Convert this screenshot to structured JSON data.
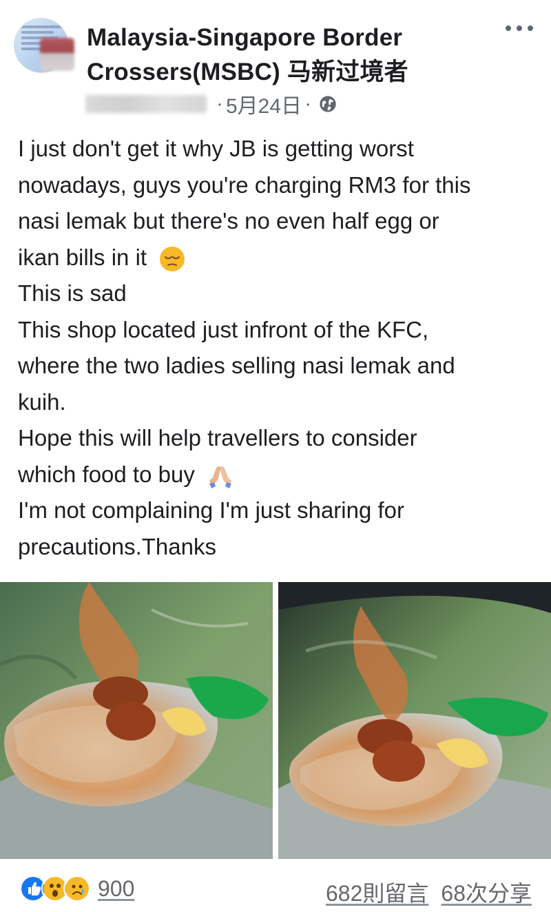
{
  "post": {
    "group_name": "Malaysia-Singapore Border Crossers(MSBC) 马新过境者",
    "meta": {
      "separator": "·",
      "date": "5月24日",
      "separator2": "·",
      "privacy_icon": "globe-icon"
    },
    "body": {
      "lines": [
        "I just don't get it why JB is getting worst",
        "nowadays, guys you're charging RM3 for this",
        "nasi lemak but there's no even half egg or",
        "ikan bills in it",
        "This is sad",
        "This shop located just infront of the KFC,",
        "where the two ladies selling nasi lemak and",
        "kuih.",
        "Hope this will help travellers to consider",
        "which food to buy",
        "I'm not complaining I'm just sharing for",
        "precautions.Thanks"
      ]
    },
    "photos": [
      {
        "name": "nasi-lemak-photo-1"
      },
      {
        "name": "nasi-lemak-photo-2"
      }
    ],
    "footer": {
      "reaction_icons": [
        "like-icon",
        "wow-icon",
        "sad-icon"
      ],
      "reaction_count": "900",
      "comments": "682則留言",
      "shares": "68次分享"
    }
  },
  "colors": {
    "text": "#1c1e21",
    "muted": "#606770",
    "like_blue": "#1877f2",
    "reaction_yellow": "#f7b928"
  }
}
